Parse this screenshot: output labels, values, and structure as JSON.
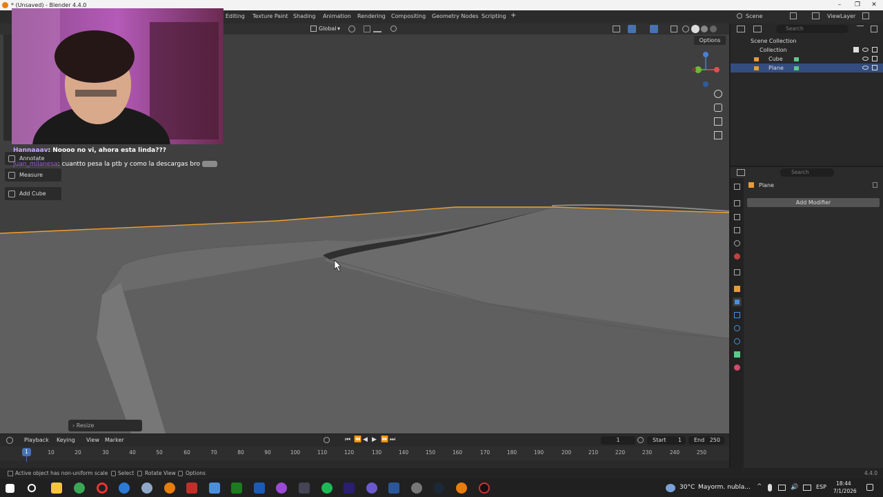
{
  "window": {
    "title": "* (Unsaved) - Blender 4.4.0",
    "controls": [
      "–",
      "❐",
      "✕"
    ]
  },
  "workspaces": [
    "Editing",
    "Texture Paint",
    "Shading",
    "Animation",
    "Rendering",
    "Compositing",
    "Geometry Nodes",
    "Scripting",
    "+"
  ],
  "scene": {
    "label": "Scene",
    "view_layer": "ViewLayer"
  },
  "viewport_header": {
    "orientation": "Global",
    "options_label": "Options"
  },
  "chat": [
    {
      "user": "Hannaaav",
      "message": "Noooo no vi, ahora esta linda???",
      "user_color": "#c9a2ff"
    },
    {
      "user": "juan_milanesa",
      "message": "cuantto pesa la ptb y como la descargas bro",
      "user_color": "#9a5bd6"
    }
  ],
  "tools": [
    "Annotate",
    "Measure",
    "Add Cube"
  ],
  "operator_panel": {
    "label": "Resize"
  },
  "outliner": {
    "search_placeholder": "Search",
    "root": "Scene Collection",
    "collection": "Collection",
    "items": [
      "Cube",
      "Plane"
    ]
  },
  "properties": {
    "search_placeholder": "Search",
    "object_name": "Plane",
    "add_modifier": "Add Modifier"
  },
  "timeline": {
    "menus": [
      "Playback",
      "Keying",
      "View",
      "Marker"
    ],
    "current_frame": "1",
    "start_label": "Start",
    "start": "1",
    "end_label": "End",
    "end": "250",
    "ticks": [
      "10",
      "20",
      "30",
      "40",
      "50",
      "60",
      "70",
      "80",
      "90",
      "100",
      "110",
      "120",
      "130",
      "140",
      "150",
      "160",
      "170",
      "180",
      "190",
      "200",
      "210",
      "220",
      "230",
      "240",
      "250"
    ],
    "playhead": "1"
  },
  "statusbar": {
    "message": "Active object has non-uniform scale",
    "hints": [
      "Select",
      "Rotate View",
      "Options"
    ],
    "version": "4.4.0"
  },
  "taskbar": {
    "weather": "30°C",
    "weather_text": "Mayorm. nubla...",
    "language": "ESP",
    "time": "18:44",
    "date": "7/1/2026"
  },
  "colors": {
    "selection_orange": "#f0a030",
    "blender_blue": "#4772b3",
    "viewport_bg": "#3f3f3f"
  }
}
